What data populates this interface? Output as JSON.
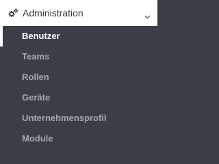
{
  "menu": {
    "section": {
      "title": "Administration",
      "icon": "gears-icon",
      "expand_icon": "chevron-down-icon",
      "expanded": true
    },
    "items": [
      {
        "label": "Benutzer",
        "active": true
      },
      {
        "label": "Teams",
        "active": false
      },
      {
        "label": "Rollen",
        "active": false
      },
      {
        "label": "Geräte",
        "active": false
      },
      {
        "label": "Unternehmensprofil",
        "active": false
      },
      {
        "label": "Module",
        "active": false
      }
    ]
  },
  "colors": {
    "sidebar_bg": "#3b3e47",
    "header_bg": "#ffffff",
    "header_text": "#333333",
    "item_text": "#a5a8b0",
    "active_text": "#ffffff",
    "active_indicator": "#ffffff"
  }
}
